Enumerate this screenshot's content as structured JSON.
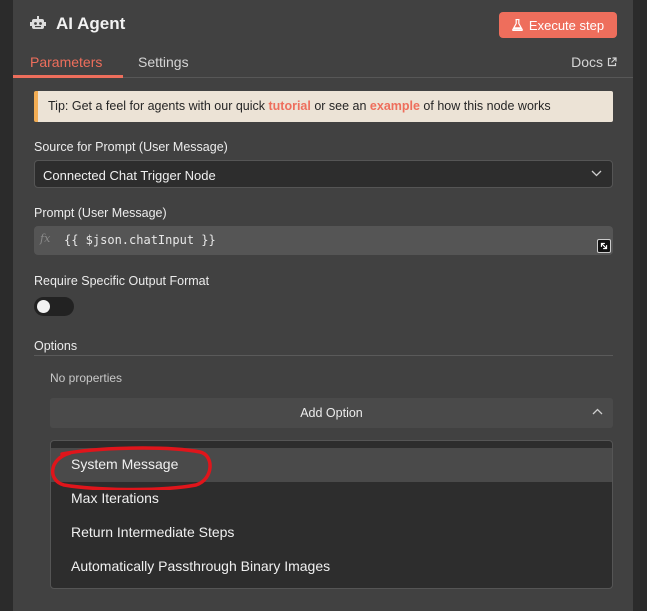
{
  "header": {
    "title": "AI Agent",
    "execute_label": "Execute step"
  },
  "tabs": {
    "parameters": "Parameters",
    "settings": "Settings",
    "docs": "Docs"
  },
  "tip": {
    "prefix": "Tip: Get a feel for agents with our quick ",
    "link1": "tutorial",
    "middle": " or see an ",
    "link2": "example",
    "suffix": " of how this node works"
  },
  "source": {
    "label": "Source for Prompt (User Message)",
    "value": "Connected Chat Trigger Node"
  },
  "prompt": {
    "label": "Prompt (User Message)",
    "fx": "fx",
    "value": "{{ $json.chatInput }}"
  },
  "output_format": {
    "label": "Require Specific Output Format",
    "enabled": false
  },
  "options": {
    "label": "Options",
    "empty_text": "No properties",
    "add_label": "Add Option",
    "items": [
      "System Message",
      "Max Iterations",
      "Return Intermediate Steps",
      "Automatically Passthrough Binary Images"
    ],
    "highlighted_index": 0
  },
  "colors": {
    "accent": "#ee6e5c",
    "annotation": "#e0151b"
  }
}
